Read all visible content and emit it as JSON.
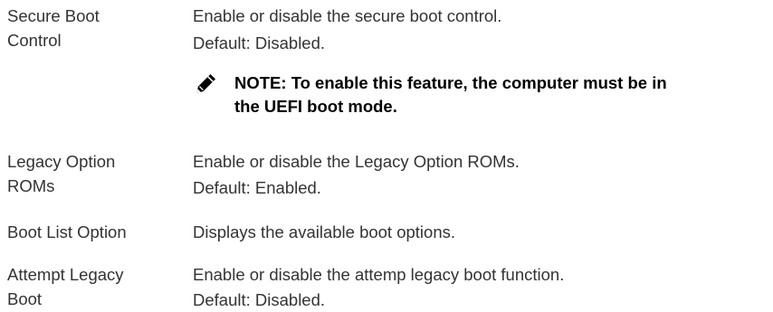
{
  "rows": [
    {
      "name_lines": [
        "Secure Boot",
        "Control"
      ],
      "desc_lines": [
        "Enable or disable the secure boot control.",
        "Default: Disabled."
      ]
    },
    {
      "name_lines": [
        "Legacy Option",
        "ROMs"
      ],
      "desc_lines": [
        "Enable or disable the Legacy Option ROMs.",
        "Default: Enabled."
      ]
    },
    {
      "name_lines": [
        "Boot List Option"
      ],
      "desc_lines": [
        "Displays the available boot options."
      ]
    },
    {
      "name_lines": [
        "Attempt Legacy",
        "Boot"
      ],
      "desc_lines": [
        "Enable or disable the attemp legacy boot function.",
        "Default: Disabled."
      ]
    }
  ],
  "note": {
    "icon": "pencil-note-icon",
    "lines": [
      "NOTE: To enable this feature, the computer must be in",
      "the UEFI boot mode."
    ]
  }
}
